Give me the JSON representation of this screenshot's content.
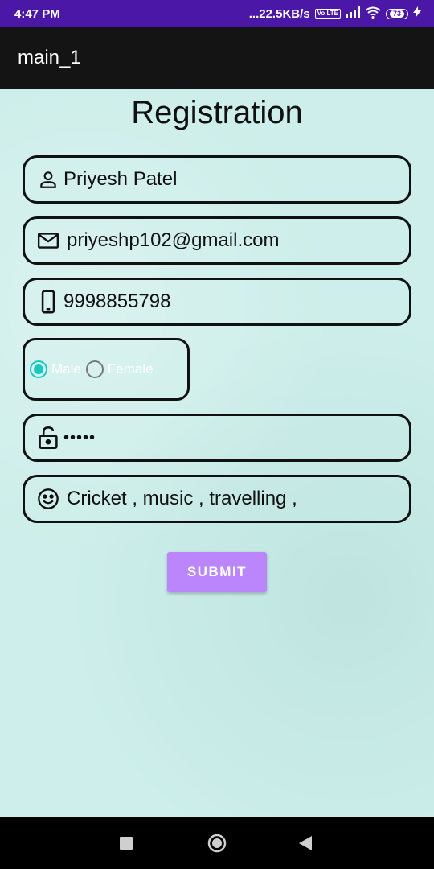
{
  "status_bar": {
    "time": "4:47 PM",
    "network_speed": "...22.5KB/s",
    "lte": "Vo LTE",
    "battery": "73",
    "icons": [
      "signal-icon",
      "wifi-icon",
      "battery-icon",
      "charging-icon"
    ]
  },
  "app_bar": {
    "title": "main_1"
  },
  "form": {
    "title": "Registration",
    "name": {
      "value": "Priyesh Patel",
      "icon": "person-icon"
    },
    "email": {
      "value": "priyeshp102@gmail.com",
      "icon": "mail-icon"
    },
    "phone": {
      "value": "9998855798",
      "icon": "phone-icon"
    },
    "gender": {
      "male_label": "Male",
      "female_label": "Female",
      "selected": "Male"
    },
    "password": {
      "value": "•••••",
      "icon": "lock-icon"
    },
    "hobbies": {
      "value": "Cricket , music , travelling ,",
      "icon": "smiley-icon"
    },
    "submit_label": "SUBMIT"
  },
  "colors": {
    "status_bar": "#4a17a6",
    "app_bar": "#141414",
    "background": "#cdeeea",
    "accent": "#18c8c0",
    "button": "#bb86fc"
  },
  "nav_bar": {
    "icons": [
      "recents-icon",
      "home-icon",
      "back-icon"
    ]
  }
}
